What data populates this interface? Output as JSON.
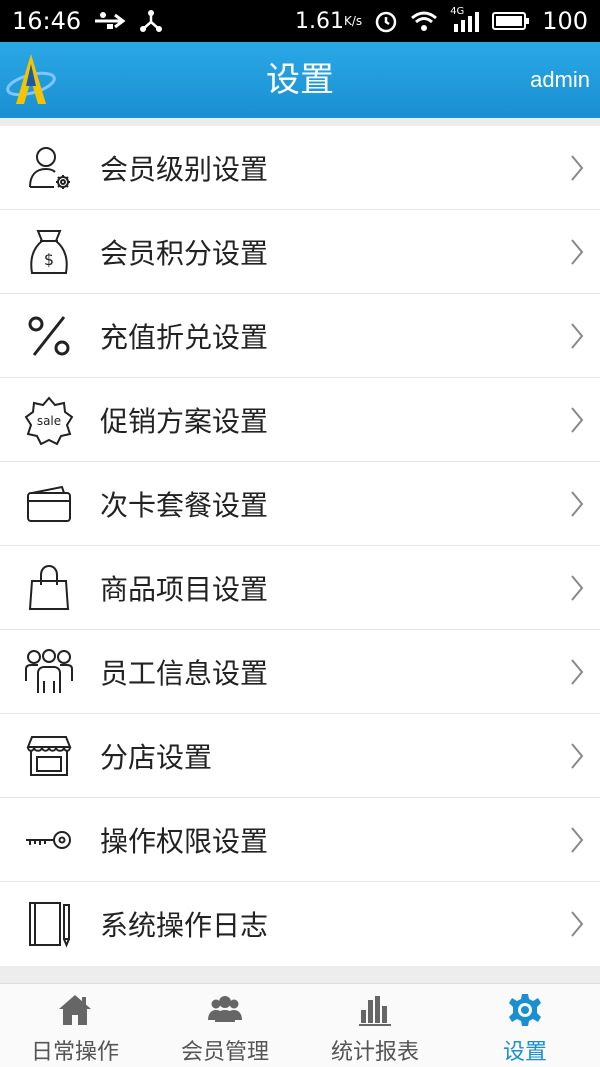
{
  "status_bar": {
    "time": "16:46",
    "speed": "1.61",
    "speed_unit": "K/s",
    "network": "4G",
    "battery": "100"
  },
  "header": {
    "title": "设置",
    "user": "admin"
  },
  "menu": [
    {
      "label": "会员级别设置",
      "icon": "member-level-icon"
    },
    {
      "label": "会员积分设置",
      "icon": "points-bag-icon"
    },
    {
      "label": "充值折兑设置",
      "icon": "percent-icon"
    },
    {
      "label": "促销方案设置",
      "icon": "sale-badge-icon"
    },
    {
      "label": "次卡套餐设置",
      "icon": "card-icon"
    },
    {
      "label": "商品项目设置",
      "icon": "shopping-bag-icon"
    },
    {
      "label": "员工信息设置",
      "icon": "staff-group-icon"
    },
    {
      "label": "分店设置",
      "icon": "store-icon"
    },
    {
      "label": "操作权限设置",
      "icon": "key-icon"
    },
    {
      "label": "系统操作日志",
      "icon": "notebook-icon"
    }
  ],
  "tabs": [
    {
      "label": "日常操作",
      "icon": "home-icon",
      "active": false
    },
    {
      "label": "会员管理",
      "icon": "members-icon",
      "active": false
    },
    {
      "label": "统计报表",
      "icon": "bar-chart-icon",
      "active": false
    },
    {
      "label": "设置",
      "icon": "gear-icon",
      "active": true
    }
  ],
  "colors": {
    "accent": "#1a8fd1",
    "header_top": "#2aa8e6",
    "background": "#ededed"
  }
}
